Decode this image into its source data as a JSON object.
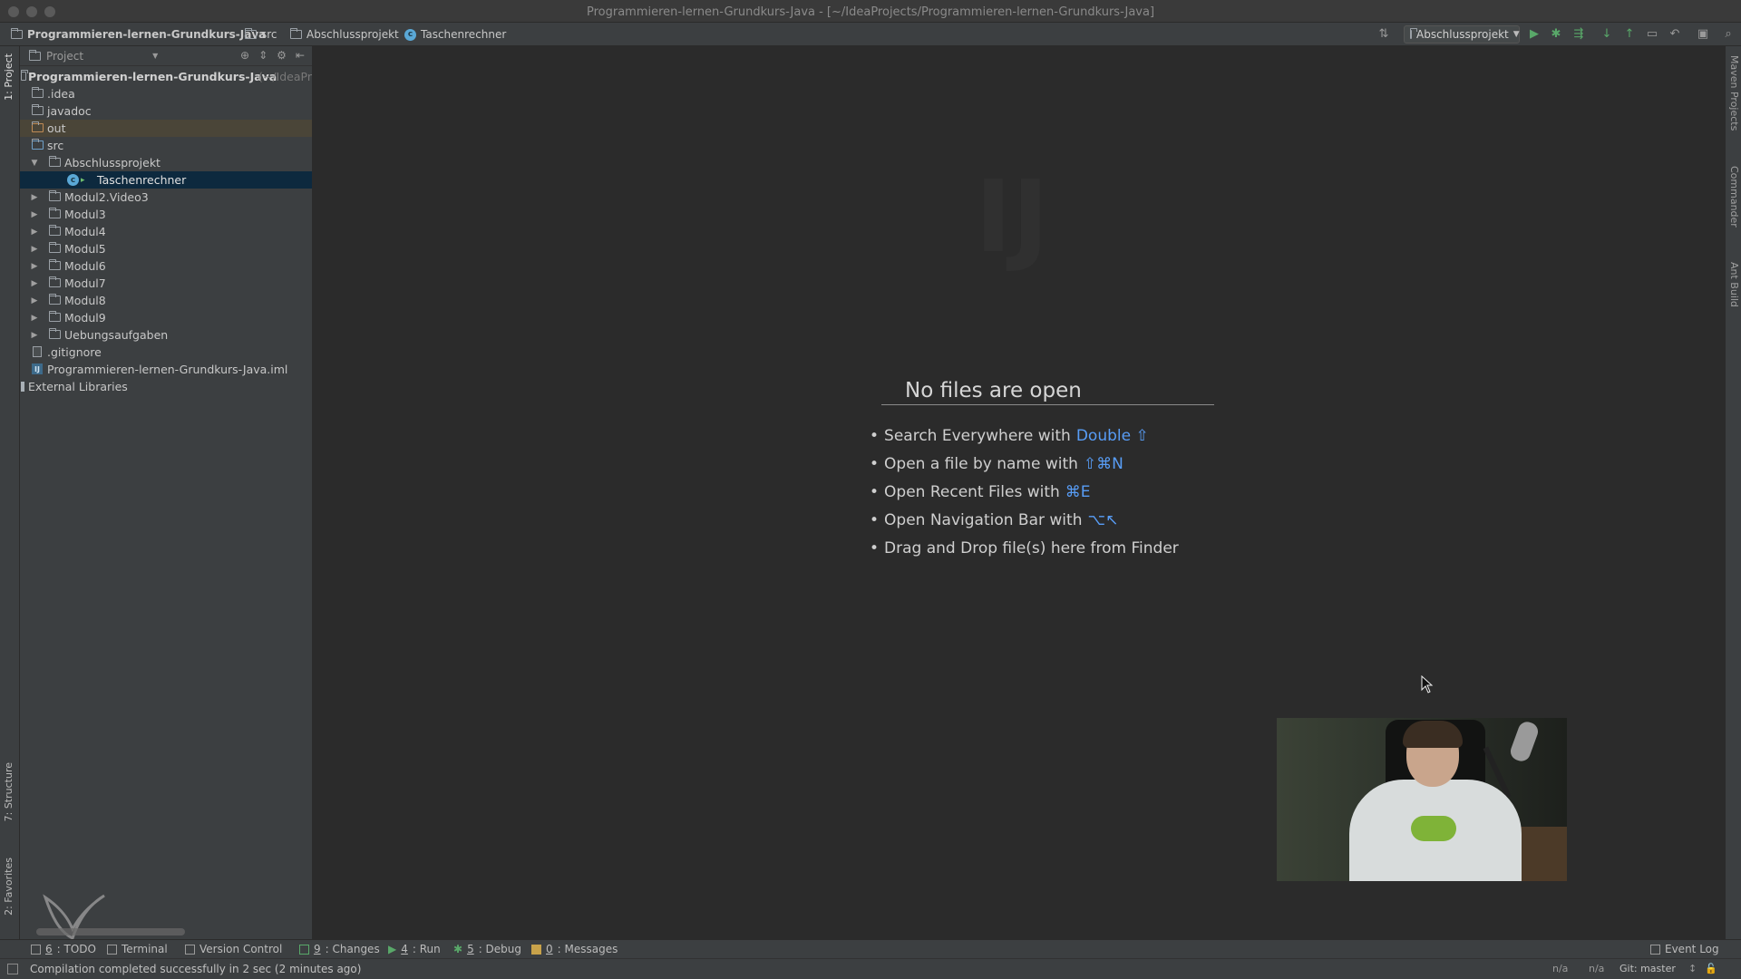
{
  "window": {
    "title": "Programmieren-lernen-Grundkurs-Java - [~/IdeaProjects/Programmieren-lernen-Grundkurs-Java]"
  },
  "breadcrumbs": [
    {
      "label": "Programmieren-lernen-Grundkurs-Java",
      "icon": "project-icon"
    },
    {
      "label": "src",
      "icon": "folder-icon"
    },
    {
      "label": "Abschlussprojekt",
      "icon": "folder-icon"
    },
    {
      "label": "Taschenrechner",
      "icon": "class-icon"
    }
  ],
  "toolbar": {
    "run_config": "Abschlussprojekt"
  },
  "left_strip": {
    "project_tab": "1: Project",
    "structure_tab": "7: Structure",
    "favorites_tab": "2: Favorites"
  },
  "right_strip": {
    "maven_tab": "Maven Projects",
    "commander_tab": "Commander",
    "ant_tab": "Ant Build"
  },
  "project_panel": {
    "header": "Project",
    "root": {
      "label": "Programmieren-lernen-Grundkurs-Java",
      "path_hint": "(~/IdeaPr"
    },
    "items": [
      {
        "label": ".idea",
        "type": "folder"
      },
      {
        "label": "javadoc",
        "type": "folder"
      },
      {
        "label": "out",
        "type": "folder"
      },
      {
        "label": "src",
        "type": "folder"
      },
      {
        "label": "Abschlussprojekt",
        "type": "package",
        "expanded": true
      },
      {
        "label": "Taschenrechner",
        "type": "class",
        "selected": true
      },
      {
        "label": "Modul2.Video3",
        "type": "package"
      },
      {
        "label": "Modul3",
        "type": "package"
      },
      {
        "label": "Modul4",
        "type": "package"
      },
      {
        "label": "Modul5",
        "type": "package"
      },
      {
        "label": "Modul6",
        "type": "package"
      },
      {
        "label": "Modul7",
        "type": "package"
      },
      {
        "label": "Modul8",
        "type": "package"
      },
      {
        "label": "Modul9",
        "type": "package"
      },
      {
        "label": "Uebungsaufgaben",
        "type": "package"
      },
      {
        "label": ".gitignore",
        "type": "file"
      },
      {
        "label": "Programmieren-lernen-Grundkurs-Java.iml",
        "type": "iml"
      },
      {
        "label": "External Libraries",
        "type": "library"
      }
    ]
  },
  "editor": {
    "empty_title": "No files are open",
    "hints": [
      {
        "text": "Search Everywhere with",
        "key": "Double ⇧"
      },
      {
        "text": "Open a file by name with",
        "key": "⇧⌘N"
      },
      {
        "text": "Open Recent Files with",
        "key": "⌘E"
      },
      {
        "text": "Open Navigation Bar with",
        "key": "⌥↖"
      },
      {
        "text": "Drag and Drop file(s) here from Finder",
        "key": ""
      }
    ]
  },
  "bottom_tabs": {
    "todo": {
      "num": "6",
      "label": ": TODO"
    },
    "terminal": "Terminal",
    "vcs": "Version Control",
    "changes": {
      "num": "9",
      "label": ": Changes"
    },
    "run": {
      "num": "4",
      "label": ": Run"
    },
    "debug": {
      "num": "5",
      "label": ": Debug"
    },
    "messages": {
      "num": "0",
      "label": ": Messages"
    },
    "event_log": "Event Log"
  },
  "status": {
    "message": "Compilation completed successfully in 2 sec (2 minutes ago)",
    "na1": "n/a",
    "na2": "n/a",
    "git": "Git: master"
  },
  "colors": {
    "accent_key": "#589df6",
    "selection": "#0d293e",
    "run_green": "#59a869"
  }
}
